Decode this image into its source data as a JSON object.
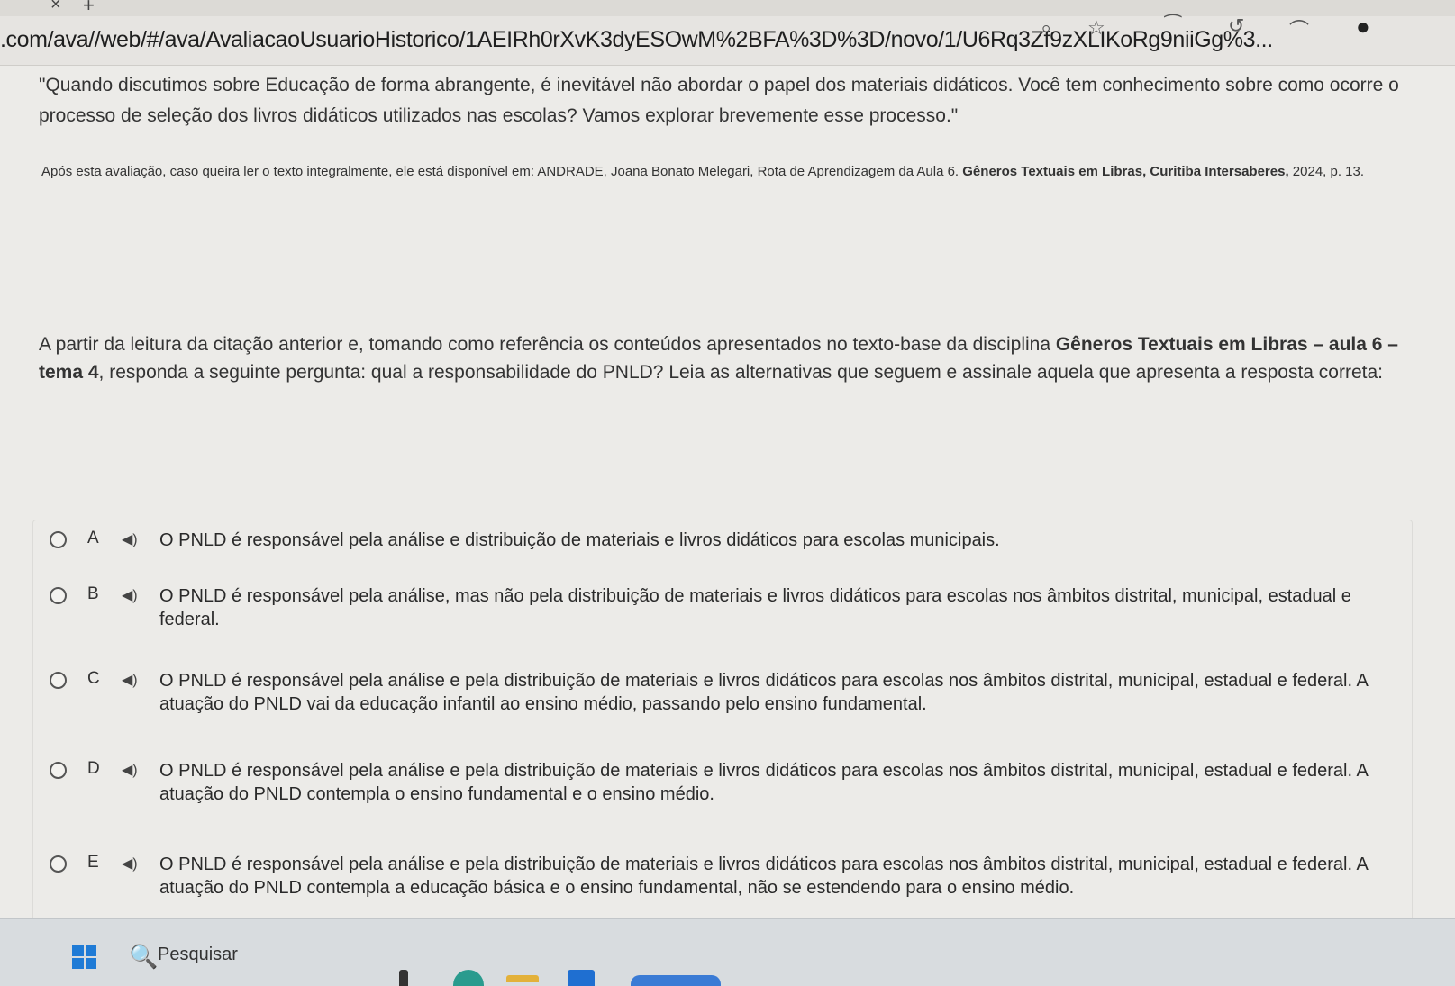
{
  "browser": {
    "url": ".com/ava//web/#/ava/AvaliacaoUsuarioHistorico/1AEIRh0rXvK3dyESOwM%2BFA%3D%3D/novo/1/U6Rq3Zf9zXLIKoRg9niiGg%3...",
    "tab_close_icon": "×",
    "new_tab_icon": "+",
    "icons": [
      "zoom-icon",
      "favorite-star-icon",
      "read-aloud-icon",
      "sync-icon",
      "profile-icon",
      "extensions-icon"
    ]
  },
  "page": {
    "quote": "\"Quando discutimos sobre Educação de forma abrangente, é inevitável não abordar o papel dos materiais didáticos. Você tem conhecimento sobre como ocorre o processo de seleção dos livros didáticos utilizados nas escolas? Vamos explorar brevemente esse processo.\"",
    "source_prefix": "Após esta avaliação, caso queira ler o texto integralmente, ele está disponível em: ANDRADE, Joana Bonato Melegari, Rota de Aprendizagem da Aula 6. ",
    "source_title": "Gêneros Textuais em Libras, Curitiba Intersaberes,",
    "source_suffix": " 2024, p. 13.",
    "question_prefix": "A partir da leitura da citação anterior e, tomando como referência os conteúdos apresentados no texto-base da disciplina ",
    "question_bold": "Gêneros Textuais em Libras – aula 6 – tema 4",
    "question_suffix": ", responda a seguinte pergunta: qual a responsabilidade do PNLD? Leia as alternativas que seguem e assinale aquela que apresenta a resposta correta:"
  },
  "options": [
    {
      "letter": "A",
      "audio": "◀)",
      "text": "O PNLD é responsável pela análise e distribuição de materiais e livros didáticos para escolas municipais."
    },
    {
      "letter": "B",
      "audio": "◀)",
      "text": "O PNLD é responsável pela análise, mas não pela distribuição de materiais e livros didáticos para escolas nos âmbitos distrital, municipal, estadual e federal."
    },
    {
      "letter": "C",
      "audio": "◀)",
      "text": "O PNLD é responsável pela análise e pela distribuição de materiais e livros didáticos para escolas nos âmbitos distrital, municipal, estadual e federal. A atuação do PNLD vai da educação infantil ao ensino médio, passando pelo ensino fundamental."
    },
    {
      "letter": "D",
      "audio": "◀)",
      "text": "O PNLD é responsável pela análise e pela distribuição de materiais e livros didáticos para escolas nos âmbitos distrital, municipal, estadual e federal. A atuação do PNLD contempla o ensino fundamental e o ensino médio."
    },
    {
      "letter": "E",
      "audio": "◀)",
      "text": "O PNLD é responsável pela análise e pela distribuição de materiais e livros didáticos para escolas nos âmbitos distrital, municipal, estadual e federal. A atuação do PNLD contempla a educação básica e o ensino fundamental, não se estendendo para o ensino médio."
    }
  ],
  "taskbar": {
    "search_label": "Pesquisar",
    "search_icon": "🔍"
  }
}
